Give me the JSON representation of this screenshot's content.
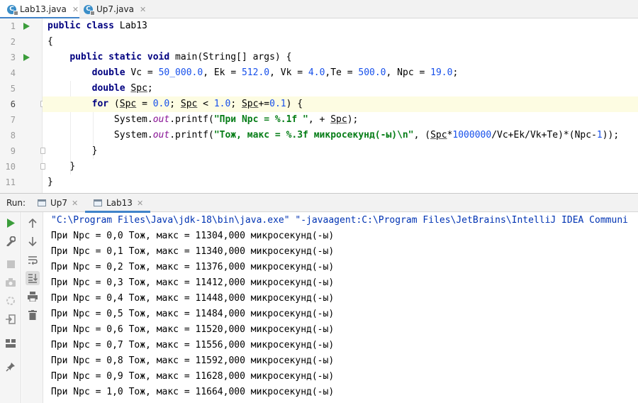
{
  "editor_tabs": [
    {
      "label": "Lab13.java",
      "active": true
    },
    {
      "label": "Up7.java",
      "active": false
    }
  ],
  "code": {
    "line_numbers": [
      "1",
      "2",
      "3",
      "4",
      "5",
      "6",
      "7",
      "8",
      "9",
      "10",
      "11"
    ],
    "current_line": 6,
    "l1": {
      "kw": "public class",
      "rest": " Lab13"
    },
    "l2": "{",
    "l3": {
      "kw1": "public static void",
      "rest": " main(String[] args) {"
    },
    "l4": {
      "kw": "double",
      "a": " Vc = ",
      "n1": "50_000.0",
      "b": ", Ek = ",
      "n2": "512.0",
      "c": ", Vk = ",
      "n3": "4.0",
      "d": ",Te = ",
      "n4": "500.0",
      "e": ", Npc = ",
      "n5": "19.0",
      "f": ";"
    },
    "l5": {
      "kw": "double",
      "var": "Spc",
      "end": ";"
    },
    "l6": {
      "kw": "for",
      "a": " (",
      "v1": "Spc",
      "b": " = ",
      "n1": "0.0",
      "c": "; ",
      "v2": "Spc",
      "d": " < ",
      "n2": "1.0",
      "e": "; ",
      "v3": "Spc",
      "f": "+=",
      "n3": "0.1",
      "g": ") {"
    },
    "l7": {
      "a": "System.",
      "out": "out",
      "b": ".printf(",
      "s": "\"При Npc = %.1f \"",
      "c": ", + ",
      "v": "Spc",
      "d": ");"
    },
    "l8": {
      "a": "System.",
      "out": "out",
      "b": ".printf(",
      "s": "\"Тож, макс = %.3f микросекунд(-ы)\\n\"",
      "c": ", (",
      "v": "Spc",
      "d": "*",
      "n": "1000000",
      "e": "/Vc+Ek/Vk+Te)*(Npc-",
      "n2": "1",
      "f": "));"
    },
    "l9": "}",
    "l10": "}",
    "l11": "}"
  },
  "run_panel": {
    "label": "Run:",
    "tabs": [
      {
        "label": "Up7",
        "active": false
      },
      {
        "label": "Lab13",
        "active": true
      }
    ],
    "toolbar_left": [
      "run-icon",
      "wrench-icon",
      "stop-icon",
      "camera-icon",
      "exit-icon",
      "exit-door-icon",
      "layout-icon",
      "pin-icon"
    ],
    "toolbar_right": [
      "up-arrow-icon",
      "down-arrow-icon",
      "soft-wrap-icon",
      "scroll-to-end-icon",
      "print-icon",
      "trash-icon"
    ],
    "console": [
      "\"C:\\Program Files\\Java\\jdk-18\\bin\\java.exe\" \"-javaagent:C:\\Program Files\\JetBrains\\IntelliJ IDEA Communi",
      "При Npc = 0,0 Тож, макс = 11304,000 микросекунд(-ы)",
      "При Npc = 0,1 Тож, макс = 11340,000 микросекунд(-ы)",
      "При Npc = 0,2 Тож, макс = 11376,000 микросекунд(-ы)",
      "При Npc = 0,3 Тож, макс = 11412,000 микросекунд(-ы)",
      "При Npc = 0,4 Тож, макс = 11448,000 микросекунд(-ы)",
      "При Npc = 0,5 Тож, макс = 11484,000 микросекунд(-ы)",
      "При Npc = 0,6 Тож, макс = 11520,000 микросекунд(-ы)",
      "При Npc = 0,7 Тож, макс = 11556,000 микросекунд(-ы)",
      "При Npc = 0,8 Тож, макс = 11592,000 микросекунд(-ы)",
      "При Npc = 0,9 Тож, макс = 11628,000 микросекунд(-ы)",
      "При Npc = 1,0 Тож, макс = 11664,000 микросекунд(-ы)"
    ]
  },
  "colors": {
    "keyword": "#000080",
    "number": "#1750eb",
    "string": "#067d17",
    "static_field": "#871094",
    "run_green": "#3b9d3b",
    "tab_accent": "#4083c9",
    "current_line": "#fdfce2"
  }
}
